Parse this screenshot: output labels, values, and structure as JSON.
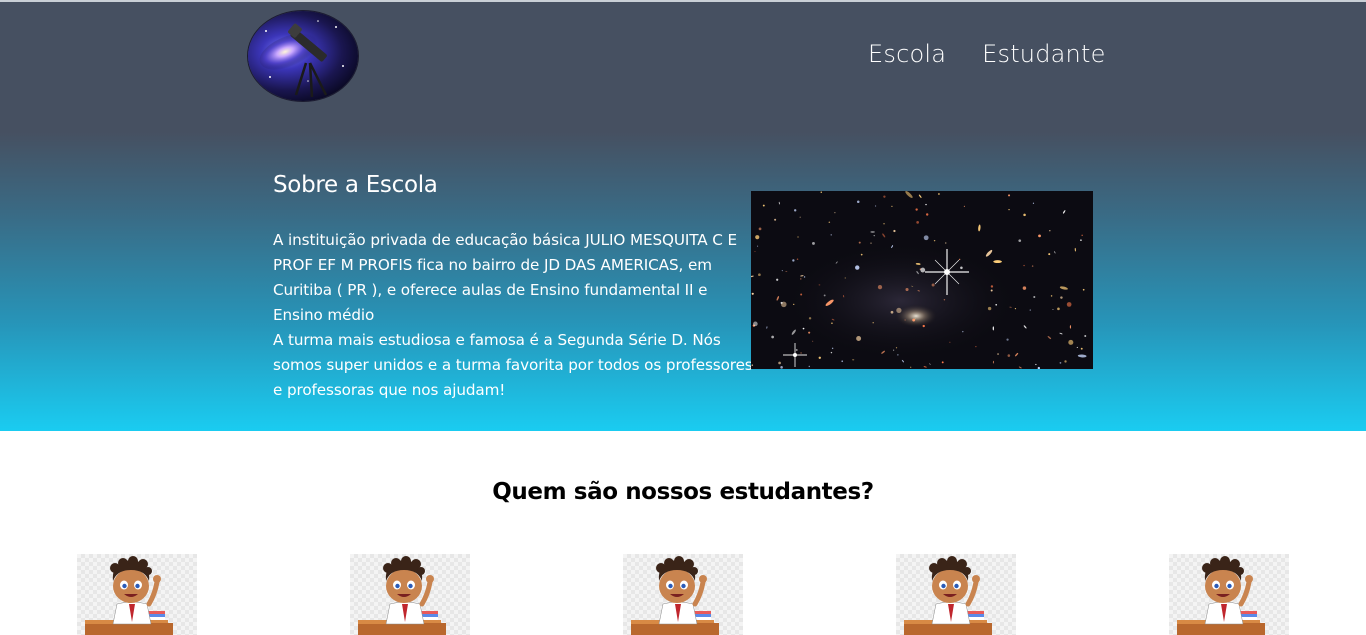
{
  "header": {
    "logo_icon": "telescope-galaxy-logo",
    "nav": [
      {
        "label": "Escola"
      },
      {
        "label": "Estudante"
      }
    ]
  },
  "about": {
    "title": "Sobre a Escola",
    "paragraph1": "A instituição privada de educação básica JULIO MESQUITA C E PROF EF M PROFIS fica no bairro de JD DAS AMERICAS, em Curitiba ( PR ), e oferece aulas de Ensino fundamental II e Ensino médio",
    "paragraph2": "A turma mais estudiosa e famosa é a Segunda Série D. Nós somos super unidos e a turma favorita por todos os professores e professoras que nos ajudam!",
    "image_icon": "deep-field-galaxy-image"
  },
  "students": {
    "title": "Quem são nossos estudantes?",
    "cards": [
      {
        "icon": "student-cartoon-image"
      },
      {
        "icon": "student-cartoon-image"
      },
      {
        "icon": "student-cartoon-image"
      },
      {
        "icon": "student-cartoon-image"
      },
      {
        "icon": "student-cartoon-image"
      }
    ]
  },
  "colors": {
    "header_bg": "#465061",
    "gradient_bottom": "#1acdf2",
    "text_light": "#ffffff"
  }
}
